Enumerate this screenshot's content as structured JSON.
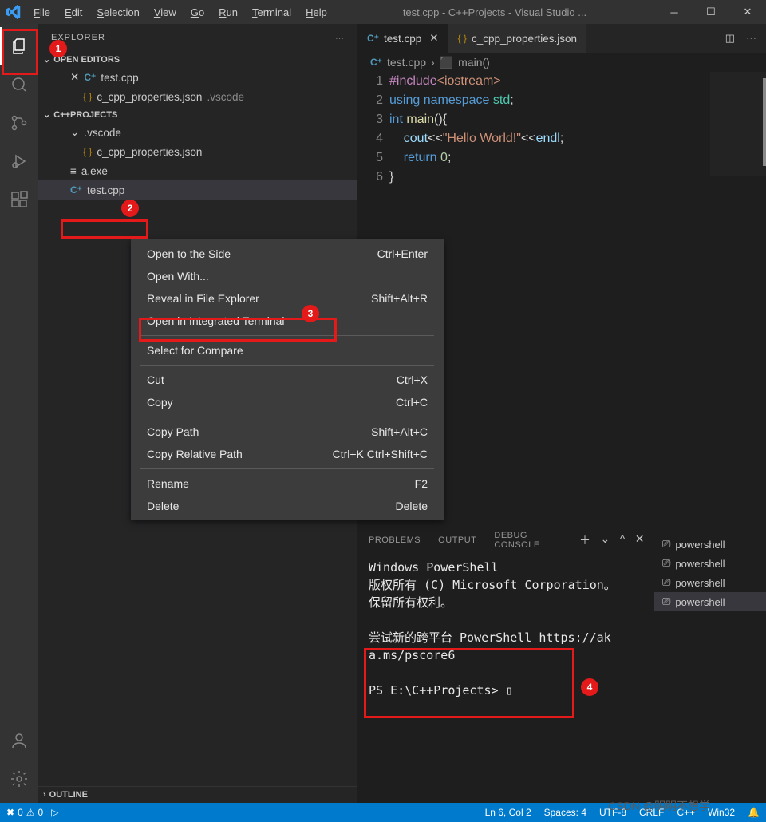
{
  "title": "test.cpp - C++Projects - Visual Studio ...",
  "menus": [
    "File",
    "Edit",
    "Selection",
    "View",
    "Go",
    "Run",
    "Terminal",
    "Help"
  ],
  "sidebar": {
    "title": "EXPLORER",
    "open_editors": "OPEN EDITORS",
    "open_items": [
      {
        "label": "test.cpp",
        "closable": true,
        "kind": "cpp"
      },
      {
        "label": "c_cpp_properties.json",
        "hint": ".vscode",
        "kind": "json"
      }
    ],
    "project": "C++PROJECTS",
    "tree": [
      {
        "label": ".vscode",
        "pad": "indent2",
        "kind": "folder"
      },
      {
        "label": "c_cpp_properties.json",
        "pad": "indent3",
        "kind": "json"
      },
      {
        "label": "a.exe",
        "pad": "indent2",
        "kind": "exe"
      },
      {
        "label": "test.cpp",
        "pad": "indent2",
        "kind": "cpp",
        "sel": true
      }
    ],
    "outline": "OUTLINE"
  },
  "tabs": [
    {
      "label": "test.cpp",
      "kind": "cpp",
      "active": true
    },
    {
      "label": "c_cpp_properties.json",
      "kind": "json",
      "active": false
    }
  ],
  "breadcrumb": {
    "file": "test.cpp",
    "symbol": "main()"
  },
  "code": {
    "lines": [
      {
        "n": "1",
        "html": "<span class='tok-pre'>#include</span><span class='tok-str'>&lt;iostream&gt;</span>"
      },
      {
        "n": "2",
        "html": "<span class='tok-kw'>using</span> <span class='tok-kw'>namespace</span> <span class='tok-type'>std</span><span class='tok-p'>;</span>"
      },
      {
        "n": "3",
        "html": "<span class='tok-kw'>int</span> <span class='tok-fn'>main</span><span class='tok-p'>(){</span>"
      },
      {
        "n": "4",
        "html": "&nbsp;&nbsp;&nbsp;&nbsp;<span class='tok-id'>cout</span><span class='tok-p'>&lt;&lt;</span><span class='tok-str'>\"Hello World!\"</span><span class='tok-p'>&lt;&lt;</span><span class='tok-id'>endl</span><span class='tok-p'>;</span>"
      },
      {
        "n": "5",
        "html": "&nbsp;&nbsp;&nbsp;&nbsp;<span class='tok-kw'>return</span> <span class='tok-num'>0</span><span class='tok-p'>;</span>"
      },
      {
        "n": "6",
        "html": "<span class='tok-p'>}</span>"
      }
    ]
  },
  "ctxmenu": [
    {
      "l": "Open to the Side",
      "r": "Ctrl+Enter"
    },
    {
      "l": "Open With...",
      "r": ""
    },
    {
      "l": "Reveal in File Explorer",
      "r": "Shift+Alt+R"
    },
    {
      "l": "Open in Integrated Terminal",
      "r": ""
    },
    {
      "sep": true
    },
    {
      "l": "Select for Compare",
      "r": ""
    },
    {
      "sep": true
    },
    {
      "l": "Cut",
      "r": "Ctrl+X"
    },
    {
      "l": "Copy",
      "r": "Ctrl+C"
    },
    {
      "sep": true
    },
    {
      "l": "Copy Path",
      "r": "Shift+Alt+C"
    },
    {
      "l": "Copy Relative Path",
      "r": "Ctrl+K Ctrl+Shift+C"
    },
    {
      "sep": true
    },
    {
      "l": "Rename",
      "r": "F2"
    },
    {
      "l": "Delete",
      "r": "Delete"
    }
  ],
  "panel": {
    "tabs": [
      "PROBLEMS",
      "OUTPUT",
      "DEBUG CONSOLE"
    ],
    "terminal_text": "Windows PowerShell\n版权所有 (C) Microsoft Corporation。\n保留所有权利。\n\n尝试新的跨平台 PowerShell https://ak\na.ms/pscore6\n\nPS E:\\C++Projects> ▯",
    "terminals": [
      "powershell",
      "powershell",
      "powershell",
      "powershell"
    ]
  },
  "status": {
    "errors": "0",
    "warnings": "0",
    "ln": "Ln 6, Col 2",
    "spaces": "Spaces: 4",
    "enc": "UTF-8",
    "eol": "CRLF",
    "lang": "C++",
    "os": "Win32",
    "bell": "🔔"
  },
  "watermark": "CSDN @明明不想学"
}
